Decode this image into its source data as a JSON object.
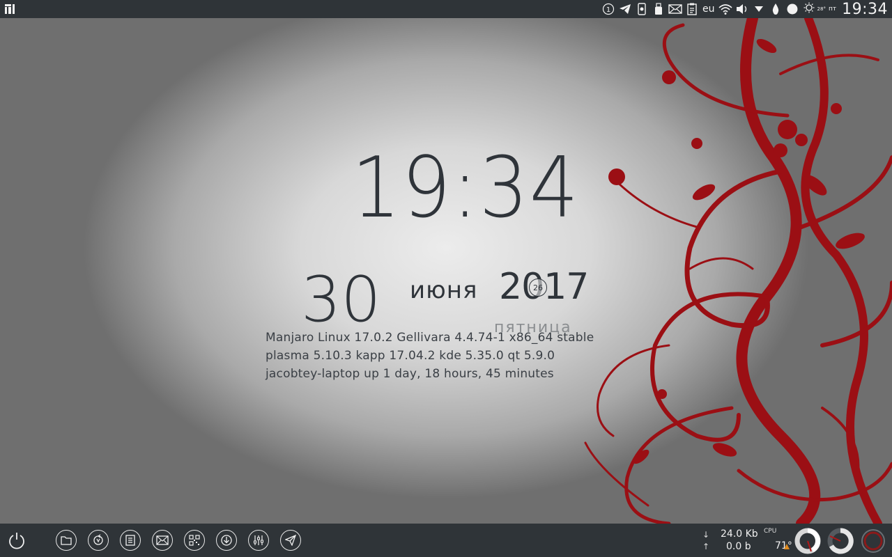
{
  "top_panel": {
    "notification_count": "1",
    "keyboard_layout": "eu",
    "weather_temp": "28°",
    "day_short": "пт",
    "clock": "19:34"
  },
  "widget": {
    "time": "19:34",
    "day": "30",
    "month": "июня",
    "year": "2017",
    "week_number": "26",
    "weekday": "пятница",
    "sysinfo": [
      "Manjaro Linux 17.0.2 Gellivara 4.4.74-1 x86_64 stable",
      "plasma 5.10.3 kapp 17.04.2 kde 5.35.0 qt 5.9.0",
      "jacobtey-laptop up 1 day, 18 hours, 45 minutes"
    ]
  },
  "bottom_panel": {
    "net_down_arrow": "↓",
    "net_down": "24.0 Kb",
    "net_up_arrow": "↑",
    "net_up": "0.0 b",
    "cpu_label": "CPU",
    "cpu_temp": "71°"
  },
  "colors": {
    "panel": "#2f3438",
    "accent_red": "#9b0f14",
    "text_dark": "#2f343a"
  },
  "icons": {
    "top": [
      "app-menu-icon",
      "notification-icon",
      "telegram-icon",
      "phone-icon",
      "usb-icon",
      "mail-icon",
      "clipboard-icon",
      "wifi-icon",
      "volume-icon",
      "menu-arrow-icon",
      "drop-icon",
      "moon-icon",
      "weather-icon"
    ],
    "launchers": [
      "files-icon",
      "sync-icon",
      "notes-icon",
      "mail-icon",
      "qr-icon",
      "download-icon",
      "mixer-icon",
      "telegram-icon"
    ]
  }
}
